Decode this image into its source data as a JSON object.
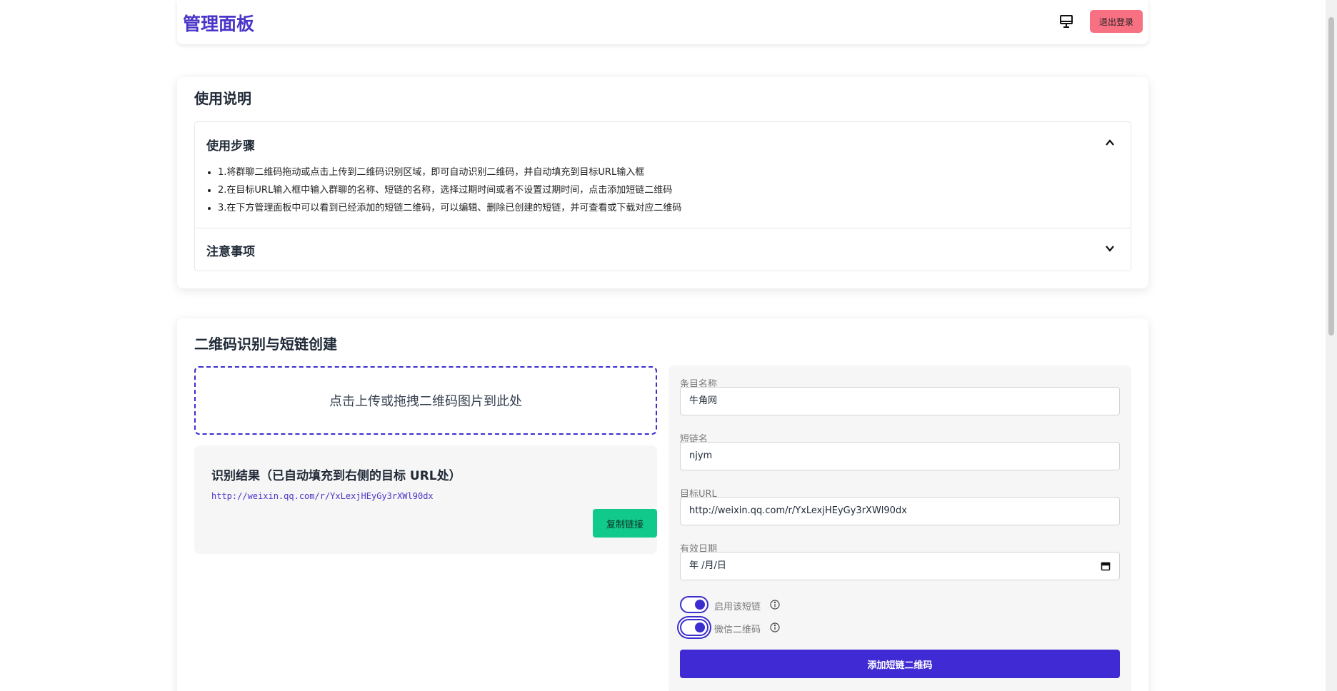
{
  "header": {
    "title": "管理面板",
    "logout_label": "退出登录",
    "monitor_icon": "monitor-icon"
  },
  "instructions": {
    "title": "使用说明",
    "steps": {
      "title": "使用步骤",
      "expanded": true,
      "items": [
        "1.将群聊二维码拖动或点击上传到二维码识别区域，即可自动识别二维码，并自动填充到目标URL输入框",
        "2.在目标URL输入框中输入群聊的名称、短链的名称，选择过期时间或者不设置过期时间，点击添加短链二维码",
        "3.在下方管理面板中可以看到已经添加的短链二维码，可以编辑、删除已创建的短链，并可查看或下载对应二维码"
      ]
    },
    "notes": {
      "title": "注意事项",
      "expanded": false
    }
  },
  "create": {
    "title": "二维码识别与短链创建",
    "dropzone_text": "点击上传或拖拽二维码图片到此处",
    "result": {
      "title": "识别结果（已自动填充到右侧的目标 URL处）",
      "url": "http://weixin.qq.com/r/YxLexjHEyGy3rXWl90dx",
      "copy_label": "复制链接"
    },
    "form": {
      "name_label": "条目名称",
      "name_value": "牛角网",
      "short_label": "短链名",
      "short_value": "njym",
      "target_label": "目标URL",
      "target_value": "http://weixin.qq.com/r/YxLexjHEyGy3rXWl90dx",
      "date_label": "有效日期",
      "date_value": "年 /月/日",
      "enable_label": "启用该短链",
      "enable_on": true,
      "wechat_label": "微信二维码",
      "wechat_on": true,
      "submit_label": "添加短链二维码"
    }
  },
  "colors": {
    "brand": "#4a35c8",
    "primary_button": "#3f2ad3",
    "logout": "#f87182",
    "copy": "#10c98a"
  }
}
